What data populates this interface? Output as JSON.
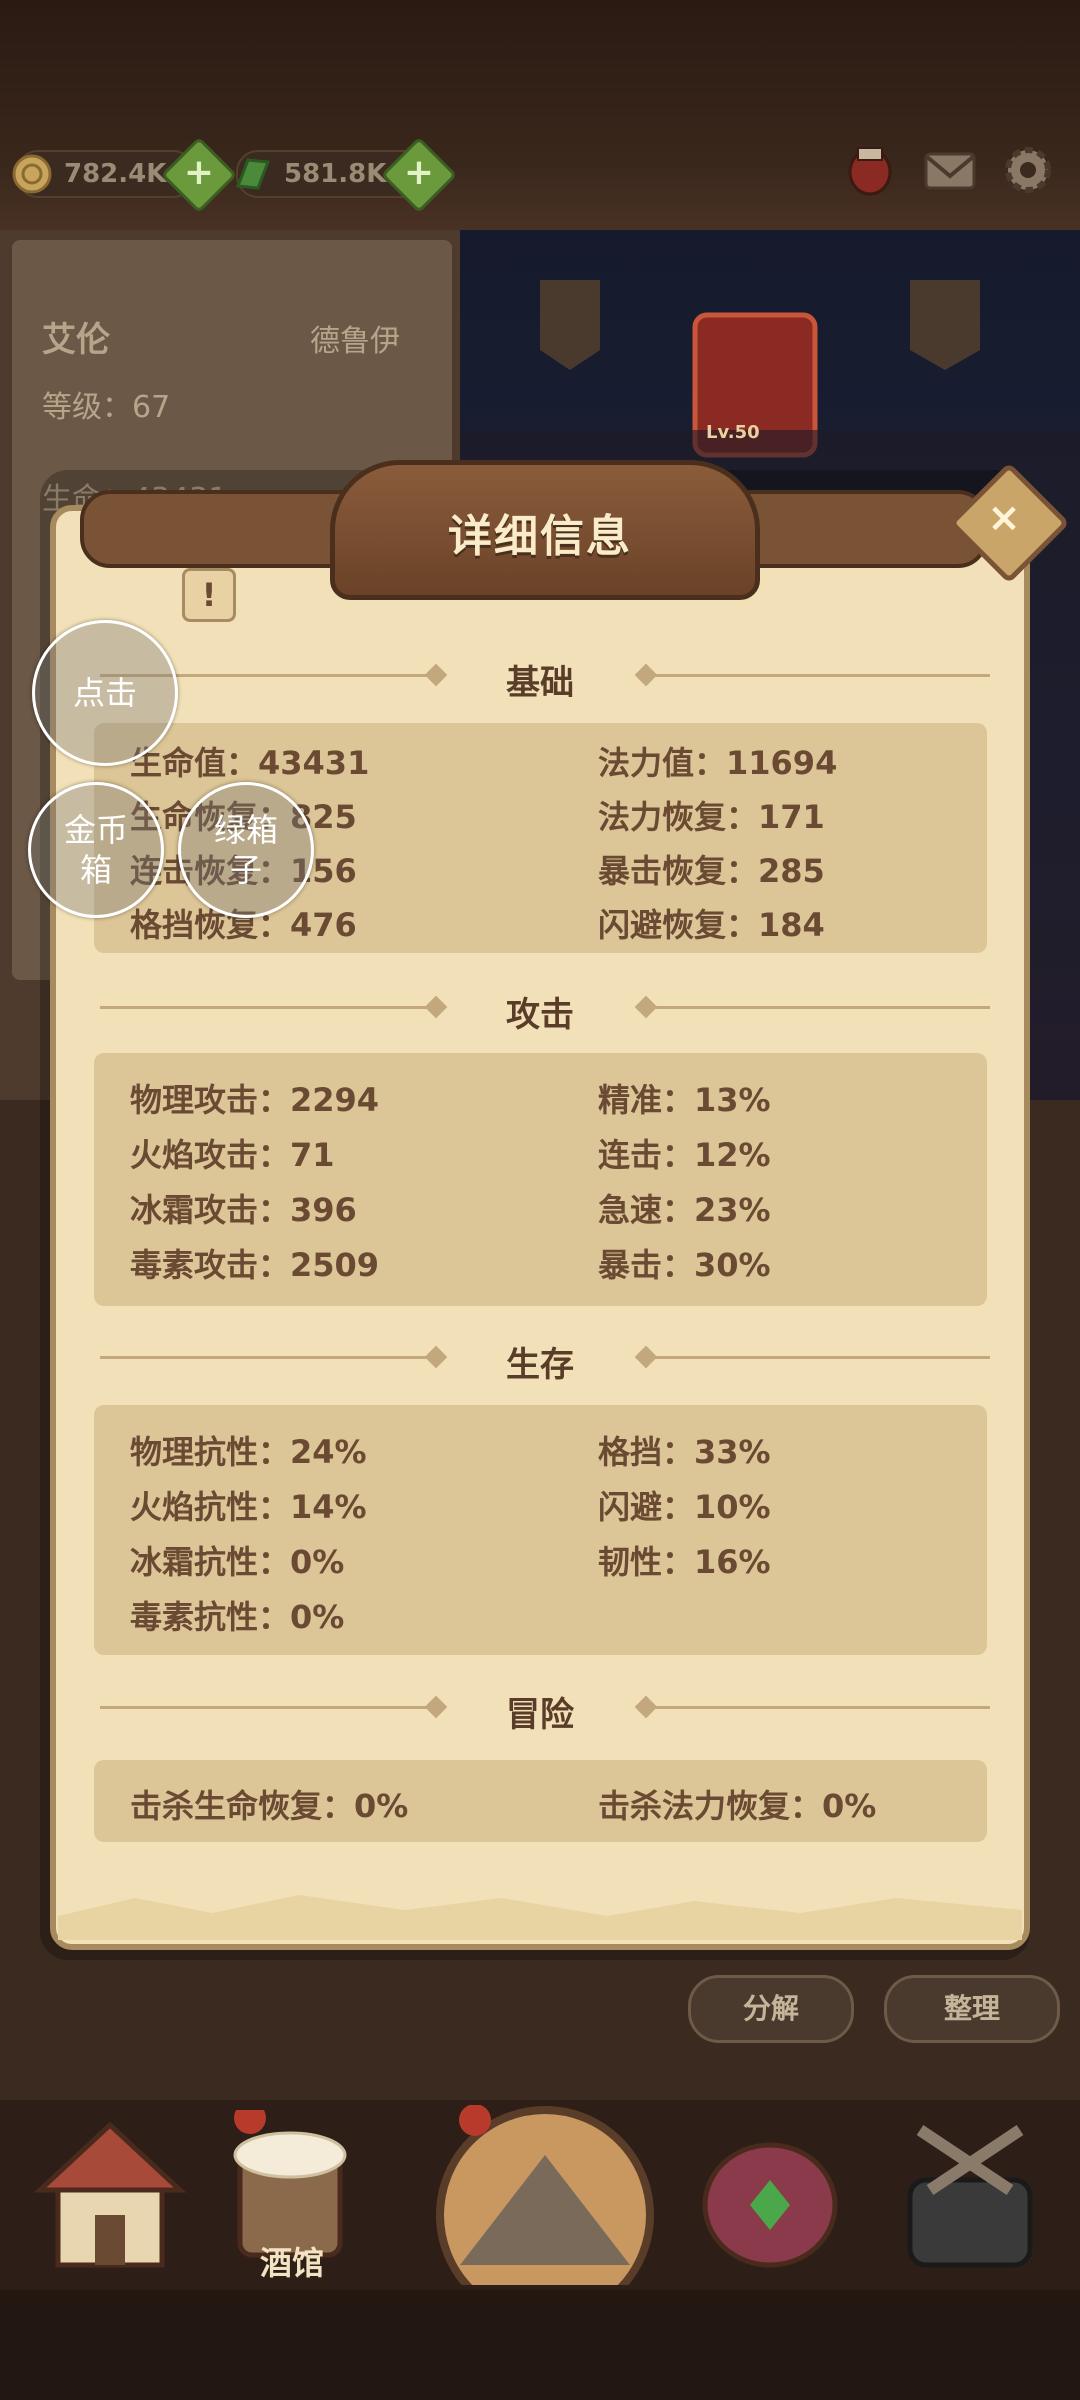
{
  "resources": {
    "gold": "782.4K",
    "gems": "581.8K"
  },
  "background": {
    "hero_name": "艾伦",
    "hero_class": "德鲁伊",
    "hero_level": "等级：67",
    "hero_hp": "生命：43431",
    "stage_hero_level": "Lv.50",
    "decompose_label": "分解",
    "organize_label": "整理",
    "nav_tavern_label": "酒馆"
  },
  "popup": {
    "title": "详细信息",
    "close_symbol": "×",
    "info_symbol": "!",
    "sections": [
      {
        "title": "基础",
        "left": [
          "生命值：43431",
          "生命恢复：825",
          "连击恢复：156",
          "格挡恢复：476"
        ],
        "right": [
          "法力值：11694",
          "法力恢复：171",
          "暴击恢复：285",
          "闪避恢复：184"
        ]
      },
      {
        "title": "攻击",
        "left": [
          "物理攻击：2294",
          "火焰攻击：71",
          "冰霜攻击：396",
          "毒素攻击：2509"
        ],
        "right": [
          "精准：13%",
          "连击：12%",
          "急速：23%",
          "暴击：30%"
        ]
      },
      {
        "title": "生存",
        "left": [
          "物理抗性：24%",
          "火焰抗性：14%",
          "冰霜抗性：0%",
          "毒素抗性：0%"
        ],
        "right": [
          "格挡：33%",
          "闪避：10%",
          "韧性：16%"
        ]
      },
      {
        "title": "冒险",
        "left": [
          "击杀生命恢复：0%"
        ],
        "right": [
          "击杀法力恢复：0%"
        ]
      }
    ]
  },
  "overlay": {
    "tap_bubble": "点击",
    "gold_chest_bubble": "金币箱",
    "green_chest_bubble": "绿箱子"
  },
  "colors": {
    "paper": "#f2e1b8",
    "stat_box": "#dcc596",
    "text_brown": "#6a4a33",
    "banner": "#7a5236"
  }
}
